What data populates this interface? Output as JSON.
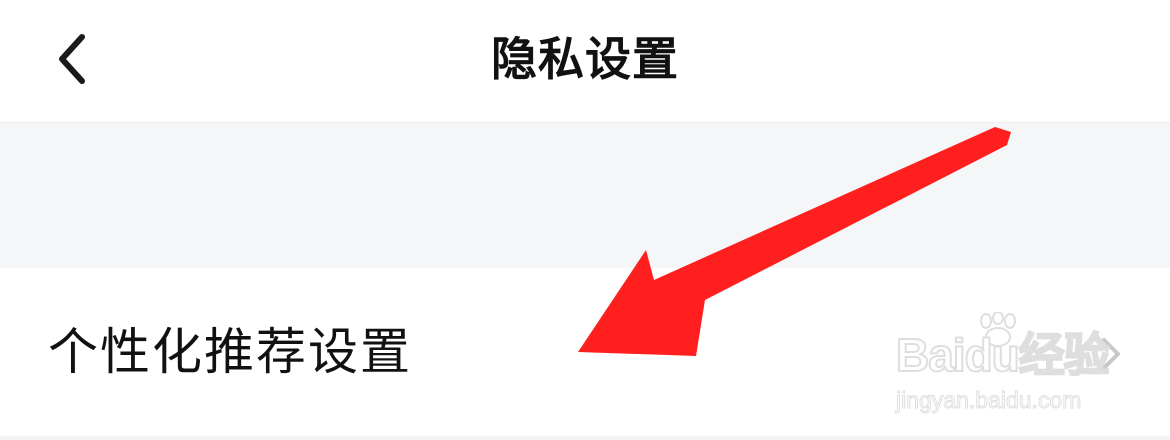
{
  "header": {
    "title": "隐私设置",
    "back_icon": "chevron-left-icon"
  },
  "settings": {
    "items": [
      {
        "label": "个性化推荐设置",
        "icon": "chevron-right-icon"
      }
    ]
  },
  "annotation": {
    "type": "red-arrow",
    "color": "#ff1f1f"
  },
  "watermark": {
    "logo": "Baidu经验",
    "url": "jingyan.baidu.com"
  },
  "colors": {
    "background": "#ffffff",
    "section_gap": "#f5f6f8",
    "text": "#111111",
    "chevron": "#c7c7cc",
    "arrow": "#ff1f1f"
  }
}
